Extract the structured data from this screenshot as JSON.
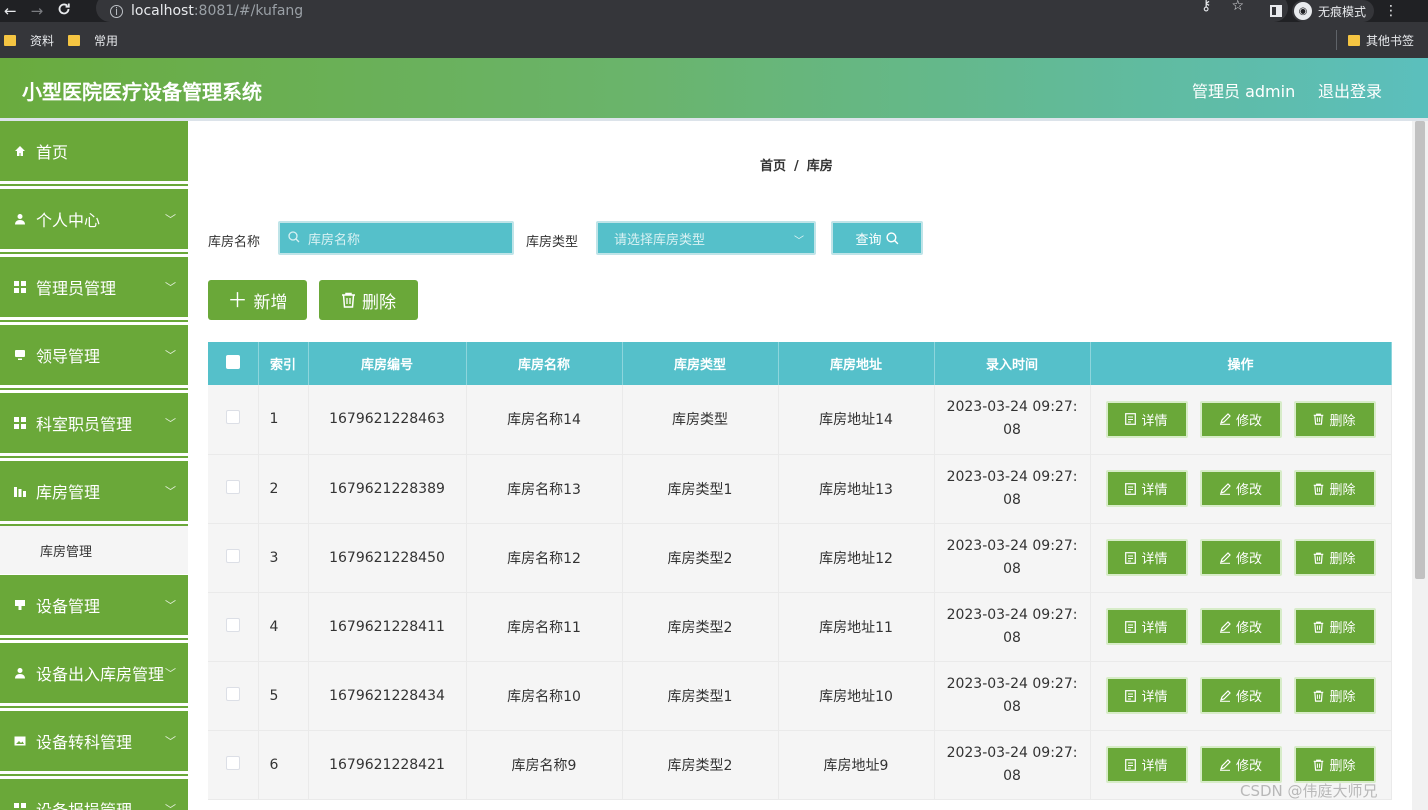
{
  "browser": {
    "nav_back": "←",
    "nav_forward": "→",
    "nav_reload": "C",
    "url_host": "localhost",
    "url_path": ":8081/#/kufang",
    "incognito_label": "无痕模式",
    "bookmarks": [
      "资料",
      "常用"
    ],
    "other_bookmarks": "其他书签"
  },
  "header": {
    "title": "小型医院医疗设备管理系统",
    "user": "管理员 admin",
    "logout": "退出登录"
  },
  "sidebar": {
    "items": [
      {
        "label": "首页",
        "icon": "home-icon",
        "has_children": false
      },
      {
        "label": "个人中心",
        "icon": "user-icon",
        "has_children": true
      },
      {
        "label": "管理员管理",
        "icon": "grid-icon",
        "has_children": true
      },
      {
        "label": "领导管理",
        "icon": "monitor-icon",
        "has_children": true
      },
      {
        "label": "科室职员管理",
        "icon": "grid-icon",
        "has_children": true
      },
      {
        "label": "库房管理",
        "icon": "chart-icon",
        "has_children": true
      },
      {
        "label": "设备管理",
        "icon": "device-icon",
        "has_children": true
      },
      {
        "label": "设备出入库房管理",
        "icon": "user-icon",
        "has_children": true
      },
      {
        "label": "设备转科管理",
        "icon": "picture-icon",
        "has_children": true
      },
      {
        "label": "设备报损管理",
        "icon": "grid-icon",
        "has_children": true
      }
    ],
    "active_sub": "库房管理"
  },
  "breadcrumb": {
    "home": "首页",
    "sep": "/",
    "current": "库房"
  },
  "search": {
    "name_label": "库房名称",
    "name_placeholder": "库房名称",
    "type_label": "库房类型",
    "type_placeholder": "请选择库房类型",
    "query_button": "查询"
  },
  "actions": {
    "add": "新增",
    "delete": "删除"
  },
  "table": {
    "columns": [
      "索引",
      "库房编号",
      "库房名称",
      "库房类型",
      "库房地址",
      "录入时间",
      "操作"
    ],
    "rows": [
      {
        "index": "1",
        "code": "1679621228463",
        "name": "库房名称14",
        "type": "库房类型",
        "address": "库房地址14",
        "time": "2023-03-24 09:27:08"
      },
      {
        "index": "2",
        "code": "1679621228389",
        "name": "库房名称13",
        "type": "库房类型1",
        "address": "库房地址13",
        "time": "2023-03-24 09:27:08"
      },
      {
        "index": "3",
        "code": "1679621228450",
        "name": "库房名称12",
        "type": "库房类型2",
        "address": "库房地址12",
        "time": "2023-03-24 09:27:08"
      },
      {
        "index": "4",
        "code": "1679621228411",
        "name": "库房名称11",
        "type": "库房类型2",
        "address": "库房地址11",
        "time": "2023-03-24 09:27:08"
      },
      {
        "index": "5",
        "code": "1679621228434",
        "name": "库房名称10",
        "type": "库房类型1",
        "address": "库房地址10",
        "time": "2023-03-24 09:27:08"
      },
      {
        "index": "6",
        "code": "1679621228421",
        "name": "库房名称9",
        "type": "库房类型2",
        "address": "库房地址9",
        "time": "2023-03-24 09:27:08"
      }
    ],
    "row_actions": {
      "detail": "详情",
      "edit": "修改",
      "delete": "删除"
    }
  },
  "watermark": "CSDN @伟庭大师兄",
  "colors": {
    "primary_green": "#6aa839",
    "accent_teal": "#55c0ca"
  }
}
